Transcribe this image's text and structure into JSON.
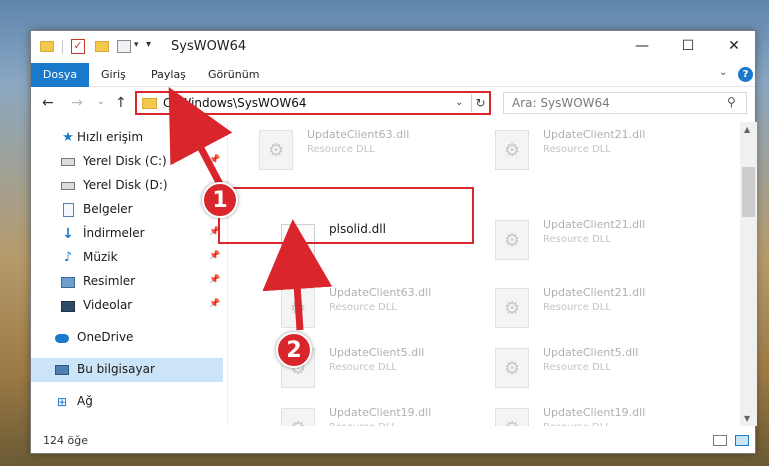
{
  "window": {
    "title": "SysWOW64",
    "controls": {
      "minimize": "—",
      "maximize": "☐",
      "close": "✕"
    }
  },
  "quick_access": {
    "caret": "▾",
    "menu": "▾"
  },
  "ribbon": {
    "tabs": [
      "Dosya",
      "Giriş",
      "Paylaş",
      "Görünüm"
    ],
    "chevron": "⌄",
    "help": "?"
  },
  "address": {
    "path": "C:\\Windows\\SysWOW64",
    "dropdown": "⌄",
    "refresh": "↻"
  },
  "nav_buttons": {
    "back": "←",
    "forward": "→",
    "recent": "⌄",
    "up": "↑"
  },
  "search": {
    "placeholder": "Ara: SysWOW64",
    "icon": "⚲"
  },
  "nav_pane": {
    "pin": "📌",
    "items": [
      {
        "label": "Hızlı erişim",
        "icon": "star-icon"
      },
      {
        "label": "Yerel Disk (C:)",
        "icon": "drive-icon",
        "pinned": true
      },
      {
        "label": "Yerel Disk (D:)",
        "icon": "drive-icon"
      },
      {
        "label": "Belgeler",
        "icon": "document-icon",
        "pinned": true
      },
      {
        "label": "İndirmeler",
        "icon": "download-icon",
        "pinned": true
      },
      {
        "label": "Müzik",
        "icon": "music-icon",
        "pinned": true
      },
      {
        "label": "Resimler",
        "icon": "pictures-icon",
        "pinned": true
      },
      {
        "label": "Videolar",
        "icon": "videos-icon",
        "pinned": true
      },
      {
        "label": "OneDrive",
        "icon": "onedrive-icon"
      },
      {
        "label": "Bu bilgisayar",
        "icon": "computer-icon",
        "selected": true
      },
      {
        "label": "Ağ",
        "icon": "network-icon"
      }
    ]
  },
  "files": {
    "gear": "⚙",
    "tiles": [
      {
        "name": "UpdateClient63.dll",
        "type": "Resource DLL"
      },
      {
        "name": "UpdateClient21.dll",
        "type": "Resource DLL"
      },
      {
        "name": "plsolid.dll",
        "type": ""
      },
      {
        "name": "UpdateClient21.dll",
        "type": "Resource DLL"
      },
      {
        "name": "UpdateClient63.dll",
        "type": "Resource DLL"
      },
      {
        "name": "UpdateClient21.dll",
        "type": "Resource DLL"
      },
      {
        "name": "UpdateClient5.dll",
        "type": "Resource DLL"
      },
      {
        "name": "UpdateClient5.dll",
        "type": "Resource DLL"
      },
      {
        "name": "UpdateClient19.dll",
        "type": "Resource DLL"
      },
      {
        "name": "UpdateClient19.dll",
        "type": "Resource DLL"
      }
    ]
  },
  "status": {
    "count": "124 öğe"
  },
  "scrollbar": {
    "up": "▲",
    "down": "▼"
  },
  "annotations": {
    "one": "1",
    "two": "2",
    "color": "#d9262c"
  }
}
